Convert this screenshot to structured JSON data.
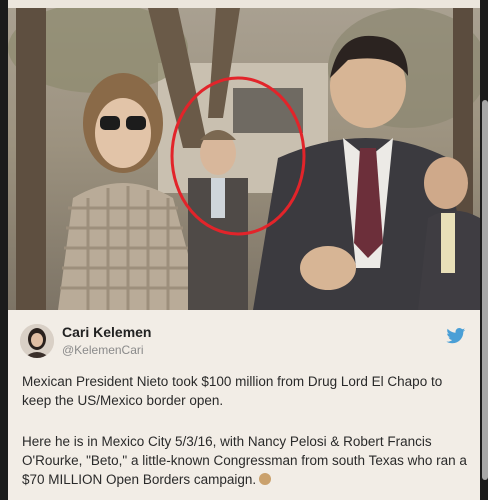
{
  "tweet": {
    "author_name": "Cari Kelemen",
    "author_handle": "@KelemenCari",
    "paragraph_1": "Mexican President Nieto took $100 million from Drug Lord El Chapo to keep the US/Mexico border open.",
    "paragraph_2": "Here he is in Mexico City 5/3/16, with Nancy Pelosi & Robert Francis O'Rourke, \"Beto,\" a little-known Congressman from south Texas who ran a  $70 MILLION Open Borders campaign."
  },
  "icons": {
    "platform": "bird-icon",
    "reaction": "thinking-face-icon"
  },
  "colors": {
    "highlight_circle": "#e2242a",
    "bird_icon": "#4a9fd6"
  }
}
